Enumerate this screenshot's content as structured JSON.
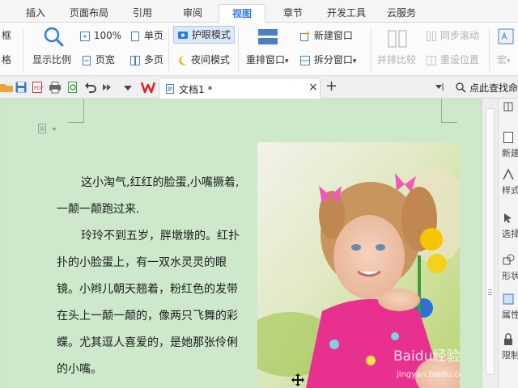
{
  "menu_tabs": [
    "插入",
    "页面布局",
    "引用",
    "审阅",
    "视图",
    "章节",
    "开发工具",
    "云服务"
  ],
  "active_tab_index": 4,
  "ribbon": {
    "left_cut_top": "框",
    "left_cut_bottom": "格",
    "zoom_label": "显示比例",
    "zoom_100": "100%",
    "single_page": "单页",
    "page_width": "页宽",
    "multi_page": "多页",
    "eye_protect": "护眼模式",
    "night_mode": "夜间模式",
    "new_window": "新建窗口",
    "rearrange_window": "重排窗口",
    "split_window": "拆分窗口",
    "side_by_side": "并排比较",
    "sync_scroll": "同步滚动",
    "reset_position": "重设位置",
    "macro": "宏"
  },
  "doc_tab": {
    "title": "文档1 *",
    "close": "×",
    "add": "+"
  },
  "find_command": "点此查找命",
  "document": {
    "paragraphs": [
      [
        "这小淘气,红红的脸蛋,小嘴撅着,",
        "一颠一颠跑过来."
      ],
      [
        "玲玲不到五岁，胖墩墩的。红扑",
        "扑的小脸蛋上，有一双水灵灵的眼",
        "镜。小辫儿朝天翘着，粉红色的发带",
        "在头上一颠一颠的，像两只飞舞的彩",
        "蝶。尤其逗人喜爱的，是她那张伶俐",
        "的小嘴。"
      ]
    ],
    "watermark_brand": "Baidu经验",
    "watermark_url": "jingyan.baidu.com"
  },
  "sidebar": [
    "新建",
    "样式",
    "选择",
    "形状",
    "属性",
    "限制"
  ],
  "colors": {
    "accent": "#2c7be5",
    "doc_bg": "#cbe6c9",
    "wps_red": "#d9262c"
  }
}
